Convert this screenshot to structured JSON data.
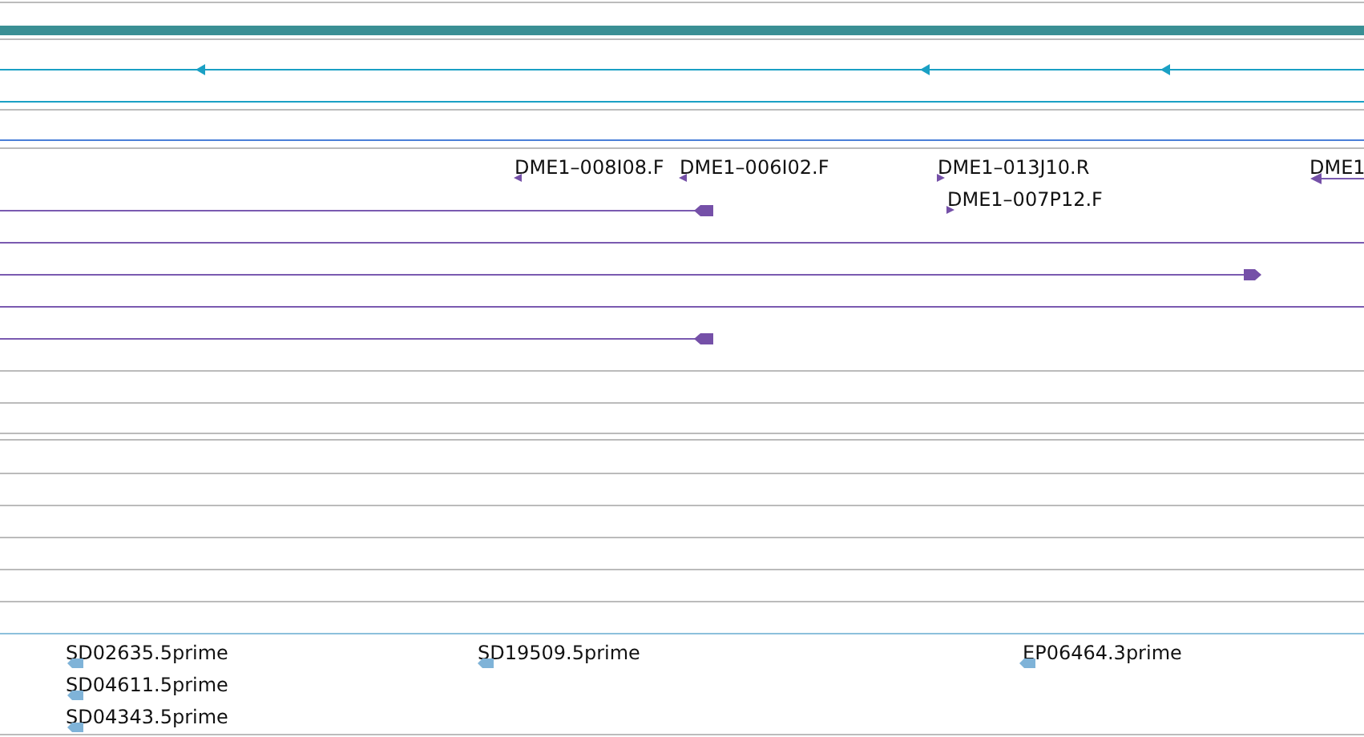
{
  "features": [
    {
      "label": "DME1–008I08.F",
      "kind": "reverse"
    },
    {
      "label": "DME1–006I02.F",
      "kind": "reverse"
    },
    {
      "label": "DME1–013J10.R",
      "kind": "forward"
    },
    {
      "label": "DME1–007P12.F",
      "kind": "forward"
    },
    {
      "label": "DME1",
      "kind": "reverse"
    }
  ],
  "reads": [
    {
      "label": "SD02635.5prime",
      "kind": "reverse"
    },
    {
      "label": "SD04611.5prime",
      "kind": "reverse"
    },
    {
      "label": "SD04343.5prime",
      "kind": "reverse"
    },
    {
      "label": "SD19509.5prime",
      "kind": "reverse"
    },
    {
      "label": "EP06464.3prime",
      "kind": "reverse"
    }
  ]
}
